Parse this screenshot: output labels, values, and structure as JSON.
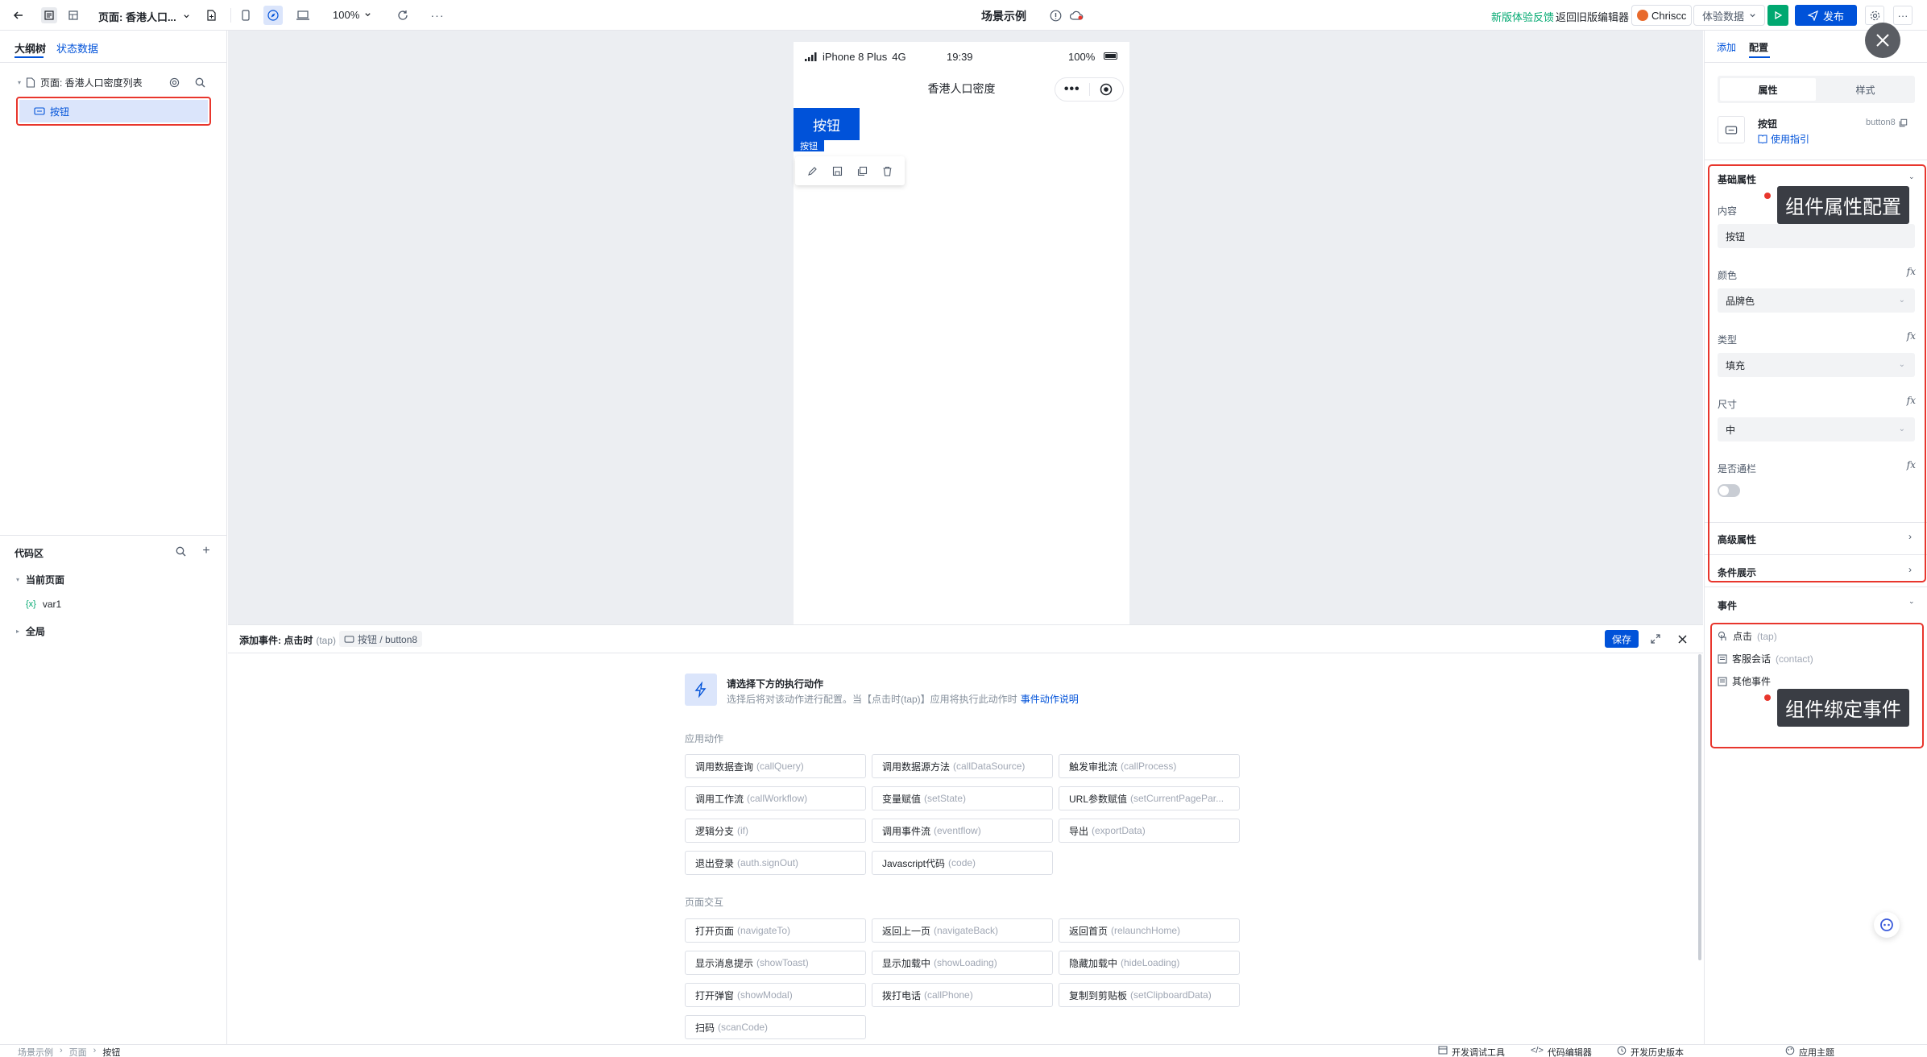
{
  "topbar": {
    "page_label": "页面: 香港人口...",
    "zoom": "100%",
    "center_title": "场景示例",
    "feedback": "新版体验反馈",
    "back_old": "返回旧版编辑器",
    "user": "Chriscc",
    "data_mode": "体验数据",
    "publish": "发布"
  },
  "left": {
    "tab_outline": "大纲树",
    "tab_state": "状态数据",
    "tree_page": "页面: 香港人口密度列表",
    "tree_button": "按钮",
    "code_title": "代码区",
    "current_page": "当前页面",
    "var1": "var1",
    "var_symbol": "{x}",
    "global": "全局"
  },
  "phone": {
    "carrier": "iPhone 8 Plus",
    "network": "4G",
    "time": "19:39",
    "battery": "100%",
    "title": "香港人口密度",
    "button_label": "按钮",
    "selected_tag": "按钮"
  },
  "event": {
    "title": "添加事件: 点击时",
    "title_en": "(tap)",
    "crumb": "按钮 / button8",
    "save": "保存",
    "prompt_title": "请选择下方的执行动作",
    "prompt_desc": "选择后将对该动作进行配置。当【点击时(tap)】应用将执行此动作时",
    "prompt_link": "事件动作说明",
    "app_section": "应用动作",
    "page_section": "页面交互",
    "app_actions": [
      {
        "zh": "调用数据查询",
        "en": "(callQuery)"
      },
      {
        "zh": "调用数据源方法",
        "en": "(callDataSource)"
      },
      {
        "zh": "触发审批流",
        "en": "(callProcess)"
      },
      {
        "zh": "调用工作流",
        "en": "(callWorkflow)"
      },
      {
        "zh": "变量赋值",
        "en": "(setState)"
      },
      {
        "zh": "URL参数赋值",
        "en": "(setCurrentPagePar..."
      },
      {
        "zh": "逻辑分支",
        "en": "(if)"
      },
      {
        "zh": "调用事件流",
        "en": "(eventflow)"
      },
      {
        "zh": "导出",
        "en": "(exportData)"
      },
      {
        "zh": "退出登录",
        "en": "(auth.signOut)"
      },
      {
        "zh": "Javascript代码",
        "en": "(code)"
      }
    ],
    "page_actions": [
      {
        "zh": "打开页面",
        "en": "(navigateTo)"
      },
      {
        "zh": "返回上一页",
        "en": "(navigateBack)"
      },
      {
        "zh": "返回首页",
        "en": "(relaunchHome)"
      },
      {
        "zh": "显示消息提示",
        "en": "(showToast)"
      },
      {
        "zh": "显示加载中",
        "en": "(showLoading)"
      },
      {
        "zh": "隐藏加载中",
        "en": "(hideLoading)"
      },
      {
        "zh": "打开弹窗",
        "en": "(showModal)"
      },
      {
        "zh": "拨打电话",
        "en": "(callPhone)"
      },
      {
        "zh": "复制到剪贴板",
        "en": "(setClipboardData)"
      },
      {
        "zh": "扫码",
        "en": "(scanCode)"
      }
    ]
  },
  "right": {
    "tab_add": "添加",
    "tab_config": "配置",
    "seg_props": "属性",
    "seg_style": "样式",
    "comp_name": "按钮",
    "comp_guide": "使用指引",
    "comp_id": "button8",
    "basic": "基础属性",
    "content_label": "内容",
    "content_value": "按钮",
    "color_label": "颜色",
    "color_value": "品牌色",
    "type_label": "类型",
    "type_value": "填充",
    "size_label": "尺寸",
    "size_value": "中",
    "banner_label": "是否通栏",
    "fx": "fx",
    "advanced": "高级属性",
    "condition": "条件展示",
    "events": "事件",
    "event_tap": "点击",
    "event_tap_en": "(tap)",
    "event_contact": "客服会话",
    "event_contact_en": "(contact)",
    "event_other": "其他事件",
    "tip_props": "组件属性配置",
    "tip_events": "组件绑定事件"
  },
  "bottom": {
    "crumb1": "场景示例",
    "crumb2": "页面",
    "crumb3": "按钮",
    "devtools": "开发调试工具",
    "code_editor": "代码编辑器",
    "history": "开发历史版本",
    "theme": "应用主题"
  },
  "colors": {
    "brand": "#0052d9",
    "red": "#e8362d",
    "green": "#00a870"
  }
}
